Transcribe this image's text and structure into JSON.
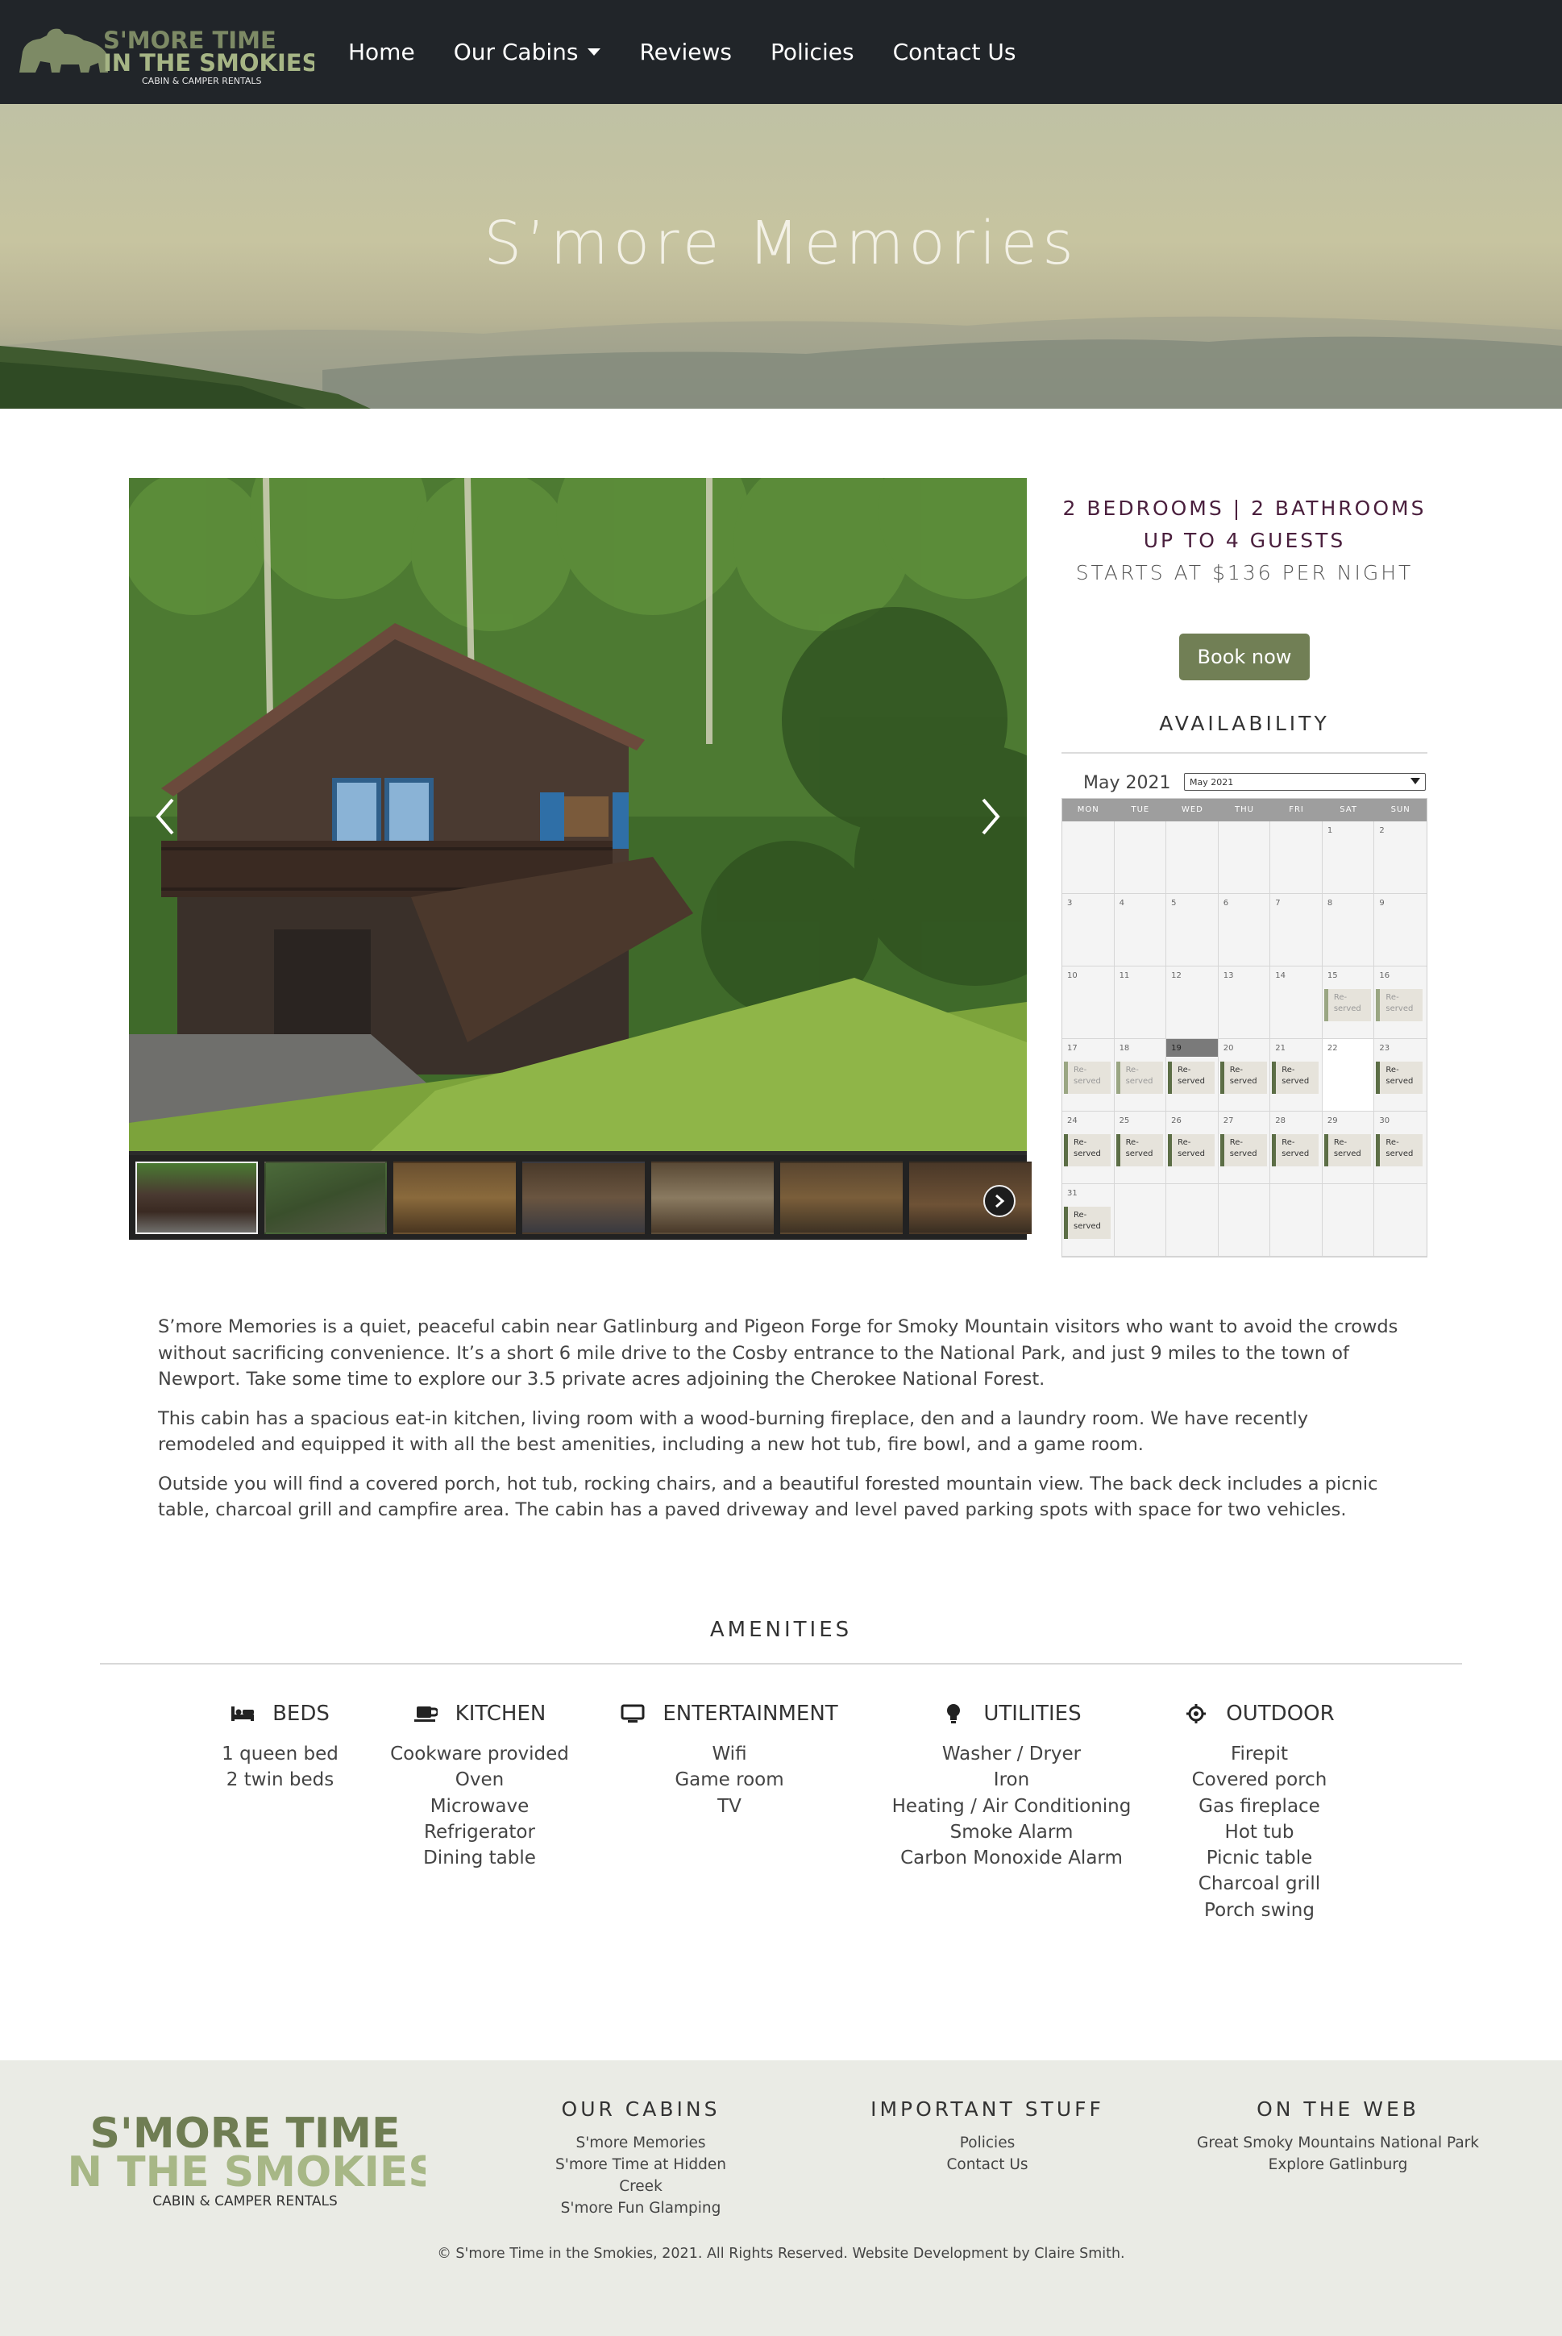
{
  "nav": {
    "logo": {
      "line1": "S'MORE TIME",
      "line2": "IN THE SMOKIES",
      "tagline": "CABIN & CAMPER RENTALS"
    },
    "links": {
      "home": "Home",
      "cabins": "Our Cabins",
      "reviews": "Reviews",
      "policies": "Policies",
      "contact": "Contact Us"
    }
  },
  "hero": {
    "title": "S’more Memories"
  },
  "gallery": {
    "prev_icon": "chevron-left-icon",
    "next_icon": "chevron-right-icon",
    "thumb_count": 7
  },
  "sidebar": {
    "spec_line1": "2 BEDROOMS | 2 BATHROOMS",
    "spec_line2": "UP TO 4 GUESTS",
    "price": "STARTS AT $136 PER NIGHT",
    "book_label": "Book now",
    "availability_title": "AVAILABILITY"
  },
  "calendar": {
    "month_label": "May 2021",
    "select_value": "May 2021",
    "days": [
      "MON",
      "TUE",
      "WED",
      "THU",
      "FRI",
      "SAT",
      "SUN"
    ],
    "reserved_label": "Re-served",
    "cells": [
      {
        "d": ""
      },
      {
        "d": ""
      },
      {
        "d": ""
      },
      {
        "d": ""
      },
      {
        "d": ""
      },
      {
        "d": "1"
      },
      {
        "d": "2"
      },
      {
        "d": "3"
      },
      {
        "d": "4"
      },
      {
        "d": "5"
      },
      {
        "d": "6"
      },
      {
        "d": "7"
      },
      {
        "d": "8"
      },
      {
        "d": "9"
      },
      {
        "d": "10"
      },
      {
        "d": "11"
      },
      {
        "d": "12"
      },
      {
        "d": "13"
      },
      {
        "d": "14"
      },
      {
        "d": "15",
        "r": "past"
      },
      {
        "d": "16",
        "r": "past"
      },
      {
        "d": "17",
        "r": "past"
      },
      {
        "d": "18",
        "r": "past"
      },
      {
        "d": "19",
        "r": "yes",
        "today": true
      },
      {
        "d": "20",
        "r": "yes"
      },
      {
        "d": "21",
        "r": "yes"
      },
      {
        "d": "22",
        "white": true
      },
      {
        "d": "23",
        "r": "yes"
      },
      {
        "d": "24",
        "r": "yes"
      },
      {
        "d": "25",
        "r": "yes"
      },
      {
        "d": "26",
        "r": "yes"
      },
      {
        "d": "27",
        "r": "yes"
      },
      {
        "d": "28",
        "r": "yes"
      },
      {
        "d": "29",
        "r": "yes"
      },
      {
        "d": "30",
        "r": "yes"
      },
      {
        "d": "31",
        "r": "yes"
      },
      {
        "d": ""
      },
      {
        "d": ""
      },
      {
        "d": ""
      },
      {
        "d": ""
      },
      {
        "d": ""
      },
      {
        "d": ""
      }
    ]
  },
  "description": {
    "p1": "S’more Memories is a quiet, peaceful cabin near Gatlinburg and Pigeon Forge for Smoky Mountain visitors who want to avoid the crowds without sacrificing convenience. It’s a short 6 mile drive to the Cosby entrance to the National Park, and just 9 miles to the town of Newport. Take some time to explore our 3.5 private acres adjoining the Cherokee National Forest.",
    "p2": "This cabin has a spacious eat-in kitchen, living room with a wood-burning fireplace, den and a laundry room. We have recently remodeled and equipped it with all the best amenities, including a new hot tub, fire bowl, and a game room.",
    "p3": "Outside you will find a covered porch, hot tub, rocking chairs, and a beautiful forested mountain view. The back deck includes a picnic table, charcoal grill and campfire area. The cabin has a paved driveway and level paved parking spots with space for two vehicles."
  },
  "amenities": {
    "title": "AMENITIES",
    "beds": {
      "title": "BEDS",
      "icon": "bed-icon",
      "items": [
        "1 queen bed",
        "2 twin beds"
      ]
    },
    "kitchen": {
      "title": "KITCHEN",
      "icon": "coffee-cup-icon",
      "items": [
        "Cookware provided",
        "Oven",
        "Microwave",
        "Refrigerator",
        "Dining table"
      ]
    },
    "entertainment": {
      "title": "ENTERTAINMENT",
      "icon": "monitor-icon",
      "items": [
        "Wifi",
        "Game room",
        "TV"
      ]
    },
    "utilities": {
      "title": "UTILITIES",
      "icon": "lightbulb-icon",
      "items": [
        "Washer / Dryer",
        "Iron",
        "Heating / Air Conditioning",
        "Smoke Alarm",
        "Carbon Monoxide Alarm"
      ]
    },
    "outdoor": {
      "title": "OUTDOOR",
      "icon": "gear-icon",
      "items": [
        "Firepit",
        "Covered porch",
        "Gas fireplace",
        "Hot tub",
        "Picnic table",
        "Charcoal grill",
        "Porch swing"
      ]
    }
  },
  "footer": {
    "logo": {
      "line1": "S'MORE TIME",
      "line2": "IN THE SMOKIES",
      "tagline": "CABIN & CAMPER RENTALS"
    },
    "cabins": {
      "title": "OUR CABINS",
      "links": [
        "S'more Memories",
        "S'more Time at Hidden Creek",
        "S'more Fun Glamping"
      ]
    },
    "important": {
      "title": "IMPORTANT STUFF",
      "links": [
        "Policies",
        "Contact Us"
      ]
    },
    "web": {
      "title": "ON THE WEB",
      "links": [
        "Great Smoky Mountains National Park",
        "Explore Gatlinburg"
      ]
    },
    "copyright": "© S'more Time in the Smokies, 2021. All Rights Reserved. Website Development by Claire Smith."
  },
  "colors": {
    "nav_bg": "#212529",
    "accent_green": "#717f55",
    "reserved_bar": "#5c6e46",
    "spec_text": "#4a1f3d",
    "footer_bg": "#eaebe5"
  }
}
